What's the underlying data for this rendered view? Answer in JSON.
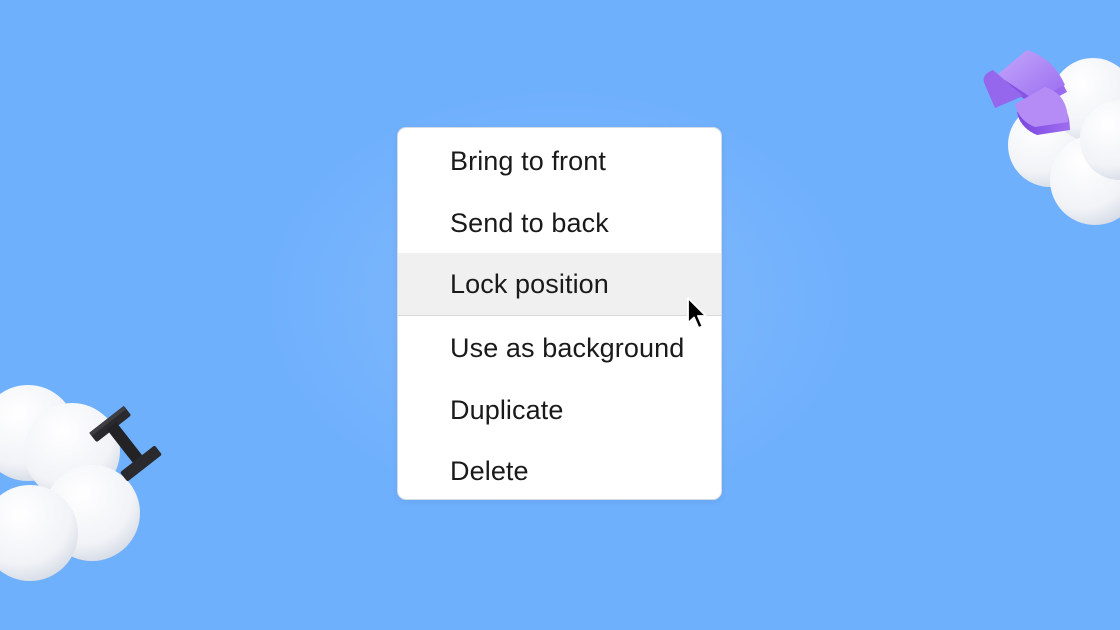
{
  "context_menu": {
    "items": [
      {
        "label": "Bring to front",
        "state": "normal"
      },
      {
        "label": "Send to back",
        "state": "normal"
      },
      {
        "label": "Lock position",
        "state": "hover"
      },
      {
        "label": "Use as background",
        "state": "normal"
      },
      {
        "label": "Duplicate",
        "state": "normal"
      },
      {
        "label": "Delete",
        "state": "normal"
      }
    ],
    "divider_after_item": 3
  },
  "colors": {
    "background": "#6fb0fd",
    "menu_background": "#ffffff",
    "hover_background": "#f0f0f0",
    "text": "#1a1a1a",
    "pie_accent": "#a77cf2"
  },
  "icons": {
    "cursor": "arrow-pointer-icon",
    "top_right_decoration": "cloud-pie-chart-icon",
    "bottom_left_decoration": "cloud-text-cursor-icon"
  }
}
